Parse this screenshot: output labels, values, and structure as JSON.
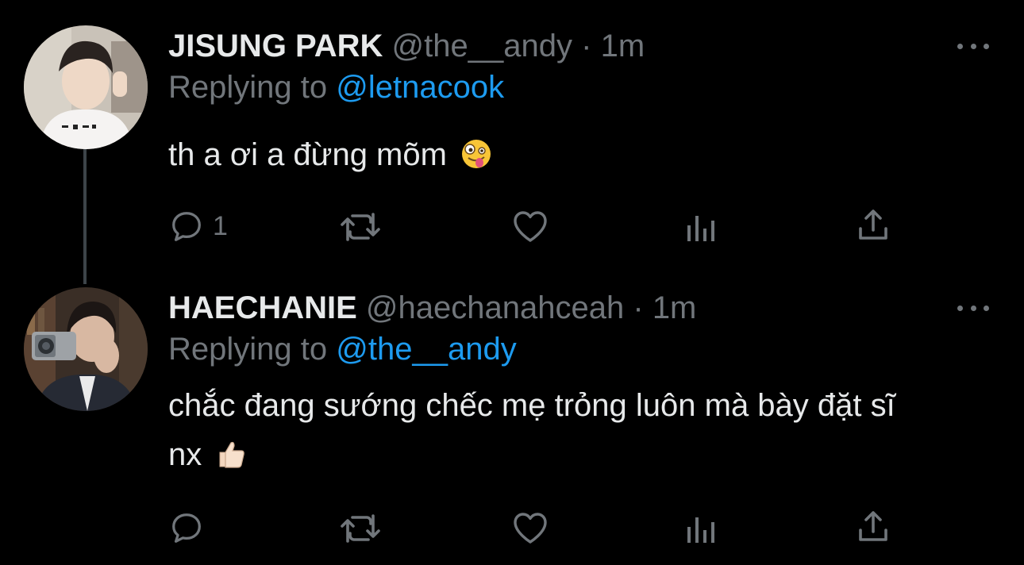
{
  "tweets": [
    {
      "display_name": "JISUNG PARK",
      "handle": "@the__andy",
      "separator": "·",
      "time": "1m",
      "replying_to_label": "Replying to",
      "replying_to_handle": "@letnacook",
      "text": "th a ơi a đừng mõm",
      "text_emoji": "zany-face",
      "actions": {
        "reply_count": "1",
        "retweet_count": "",
        "like_count": ""
      }
    },
    {
      "display_name": "HAECHANIE",
      "handle": "@haechanahceah",
      "separator": "·",
      "time": "1m",
      "replying_to_label": "Replying to",
      "replying_to_handle": "@the__andy",
      "text_line1": "chắc đang sướng chếc mẹ trỏng luôn mà bày đặt sĩ",
      "text_line2": "nx",
      "text_emoji": "thumbs-up-light-skin",
      "actions": {
        "reply_count": "",
        "retweet_count": "",
        "like_count": ""
      }
    }
  ],
  "colors": {
    "background": "#000000",
    "text_primary": "#e7e9ea",
    "text_secondary": "#71767b",
    "link": "#1d9bf0",
    "thread_line": "#3d4449"
  }
}
